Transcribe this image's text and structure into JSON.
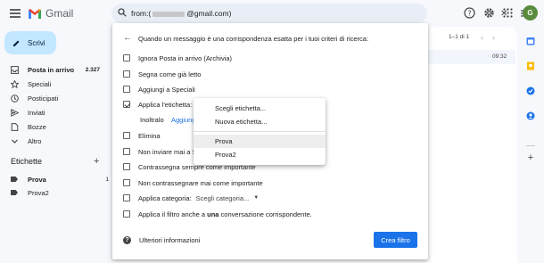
{
  "app": {
    "name": "Gmail",
    "avatar_letter": "G",
    "brand_color": "#ea4335",
    "accent": "#1a73e8"
  },
  "search": {
    "prefix": "from:(",
    "suffix": "@gmail.com)"
  },
  "sidebar": {
    "compose_label": "Scrivi",
    "items": [
      {
        "label": "Posta in arrivo",
        "count": "2.327",
        "icon": "inbox-icon",
        "bold": true
      },
      {
        "label": "Speciali",
        "count": "",
        "icon": "star-icon"
      },
      {
        "label": "Posticipati",
        "count": "",
        "icon": "clock-icon"
      },
      {
        "label": "Inviati",
        "count": "",
        "icon": "send-icon"
      },
      {
        "label": "Bozze",
        "count": "",
        "icon": "draft-icon"
      },
      {
        "label": "Altro",
        "count": "",
        "icon": "chevron-down-icon"
      }
    ],
    "labels_title": "Etichette",
    "labels": [
      {
        "label": "Prova",
        "count": "1",
        "bold": true
      },
      {
        "label": "Prova2",
        "count": ""
      }
    ]
  },
  "list": {
    "pager": "1–1 di 1",
    "email_time": "09:32"
  },
  "filter_dialog": {
    "title": "Quando un messaggio è una corrispondenza esatta per i tuoi criteri di ricerca:",
    "options": [
      {
        "label": "Ignora Posta in arrivo (Archivia)",
        "checked": false
      },
      {
        "label": "Segna come già letto",
        "checked": false
      },
      {
        "label": "Aggiungi a Speciali",
        "checked": false
      },
      {
        "label": "Applica l'etichetta:",
        "checked": true
      },
      {
        "label": "Elimina",
        "checked": false
      },
      {
        "label": "Non inviare mai a Spam",
        "checked": false
      },
      {
        "label": "Contrassegna sempre come importante",
        "checked": false
      },
      {
        "label": "Non contrassegnare mai come importante",
        "checked": false
      },
      {
        "label": "Applica categoria:",
        "checked": false
      },
      {
        "label_pre": "Applica il filtro anche a ",
        "label_bold": "una",
        "label_post": " conversazione corrispondente.",
        "checked": false
      }
    ],
    "forward_label": "Inoltralo",
    "forward_link": "Aggiungi",
    "category_select": "Scegli categoria...",
    "info": "Ulteriori informazioni",
    "create_button": "Crea filtro"
  },
  "label_dropdown": {
    "items": [
      "Scegli etichetta...",
      "Nuova etichetta..."
    ],
    "labels": [
      "Prova",
      "Prova2"
    ],
    "highlighted": "Prova"
  }
}
